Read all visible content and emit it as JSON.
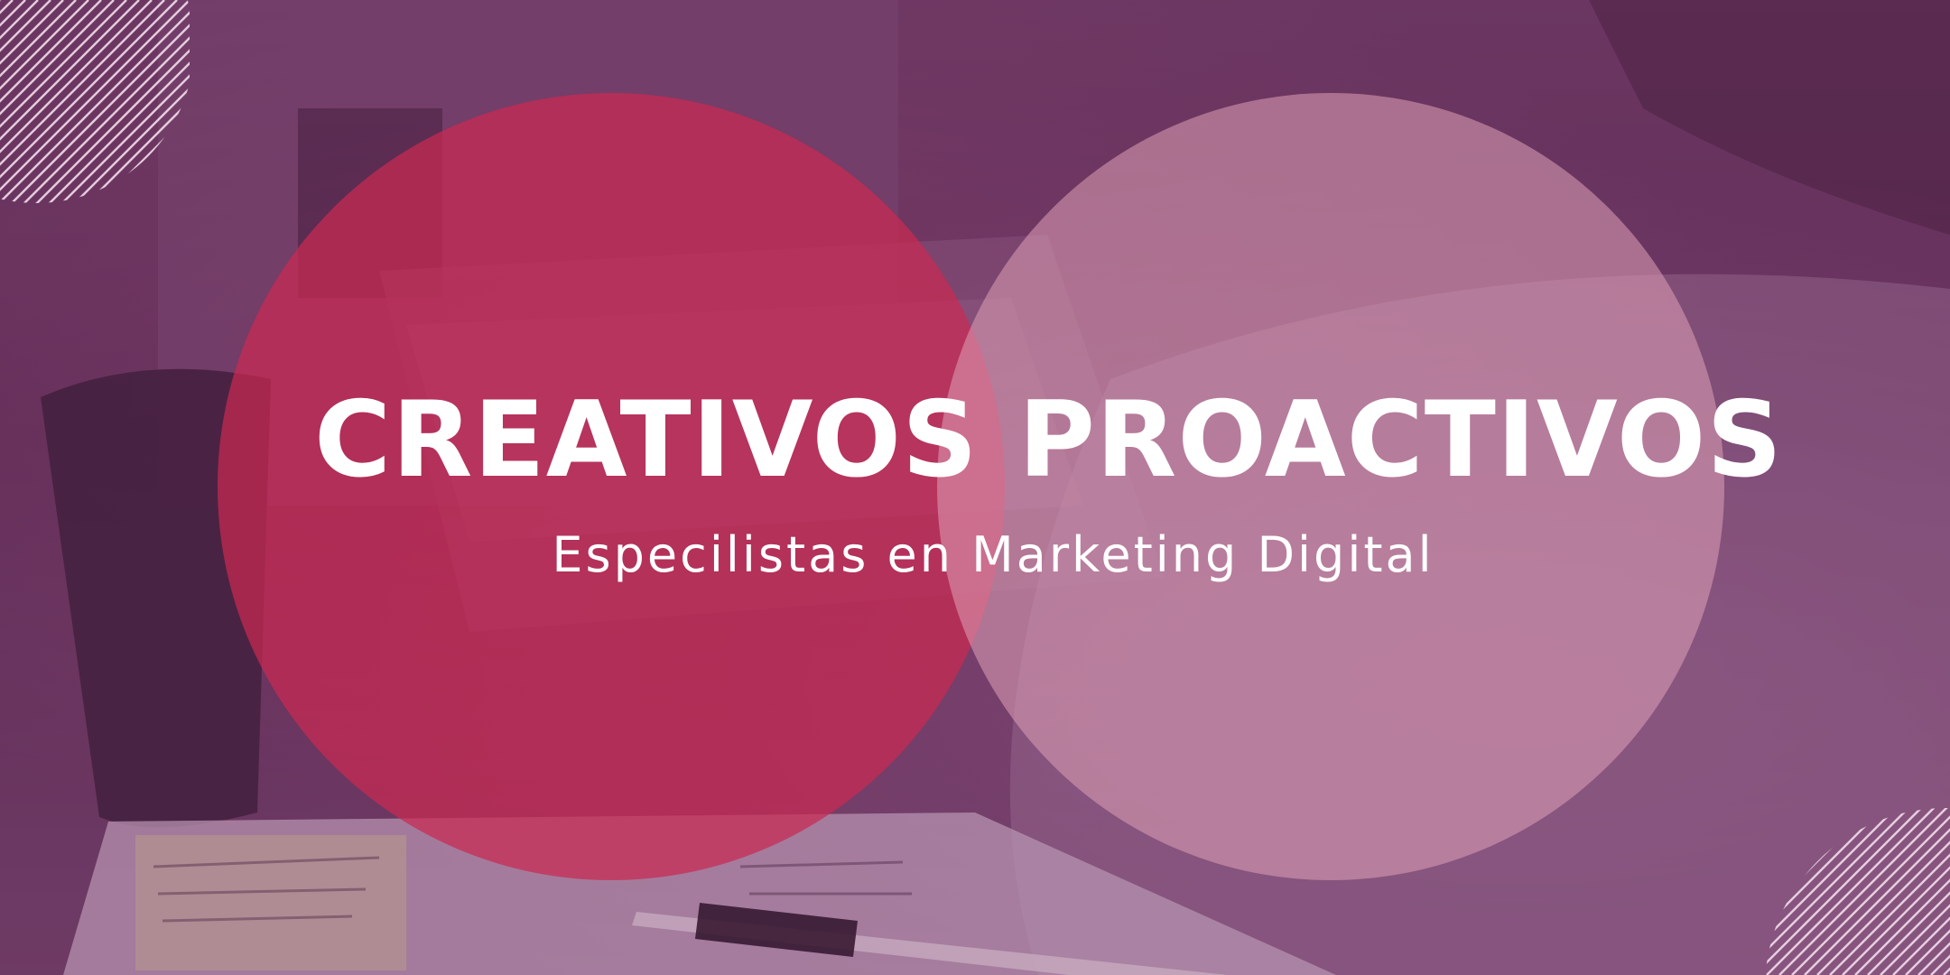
{
  "banner": {
    "headline_left": "CREATIVOS",
    "headline_right": "PROACTIVOS",
    "subtitle": "Especilistas en Marketing Digital"
  },
  "colors": {
    "overlay_purple": "#5e2e54",
    "circle_left": "#c92a52",
    "circle_right": "#e0a0b6",
    "text": "#ffffff"
  }
}
